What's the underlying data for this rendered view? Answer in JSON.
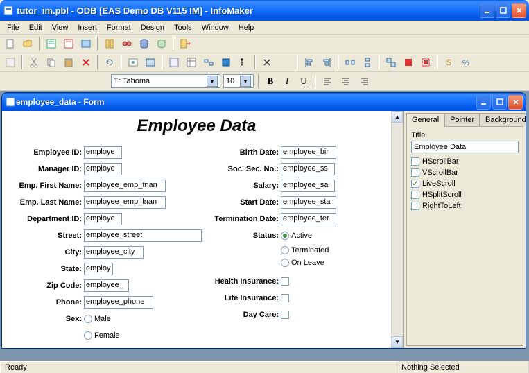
{
  "window": {
    "title": "tutor_im.pbl - ODB [EAS Demo DB V115 IM]  - InfoMaker"
  },
  "menu": {
    "file": "File",
    "edit": "Edit",
    "view": "View",
    "insert": "Insert",
    "format": "Format",
    "design": "Design",
    "tools": "Tools",
    "window": "Window",
    "help": "Help"
  },
  "font": {
    "name": "Tahoma",
    "size": "10",
    "bold": "B",
    "italic": "I",
    "underline": "U"
  },
  "child": {
    "title": "employee_data - Form"
  },
  "form": {
    "title": "Employee Data",
    "labels": {
      "employee_id": "Employee ID:",
      "manager_id": "Manager ID:",
      "emp_first": "Emp. First Name:",
      "emp_last": "Emp. Last Name:",
      "dept_id": "Department ID:",
      "street": "Street:",
      "city": "City:",
      "state": "State:",
      "zip": "Zip Code:",
      "phone": "Phone:",
      "sex": "Sex:",
      "birth": "Birth Date:",
      "ssn": "Soc. Sec. No.:",
      "salary": "Salary:",
      "start": "Start Date:",
      "term": "Termination Date:",
      "status": "Status:",
      "health": "Health Insurance:",
      "life": "Life Insurance:",
      "daycare": "Day Care:"
    },
    "values": {
      "employee_id": "employe",
      "manager_id": "employe",
      "emp_first": "employee_emp_fnan",
      "emp_last": "employee_emp_lnan",
      "dept_id": "employe",
      "street": "employee_street",
      "city": "employee_city",
      "state": "employ",
      "zip": "employee_",
      "phone": "employee_phone",
      "birth": "employee_bir",
      "ssn": "employee_ss",
      "salary": "employee_sa",
      "start": "employee_sta",
      "term": "employee_ter"
    },
    "sex": {
      "male": "Male",
      "female": "Female"
    },
    "status": {
      "active": "Active",
      "terminated": "Terminated",
      "onleave": "On Leave"
    }
  },
  "props": {
    "tabs": {
      "general": "General",
      "pointer": "Pointer",
      "background": "Background"
    },
    "title_label": "Title",
    "title_value": "Employee Data",
    "hscroll": "HScrollBar",
    "vscroll": "VScrollBar",
    "livescroll": "LiveScroll",
    "hsplit": "HSplitScroll",
    "rtl": "RightToLeft"
  },
  "status": {
    "ready": "Ready",
    "sel": "Nothing Selected"
  }
}
